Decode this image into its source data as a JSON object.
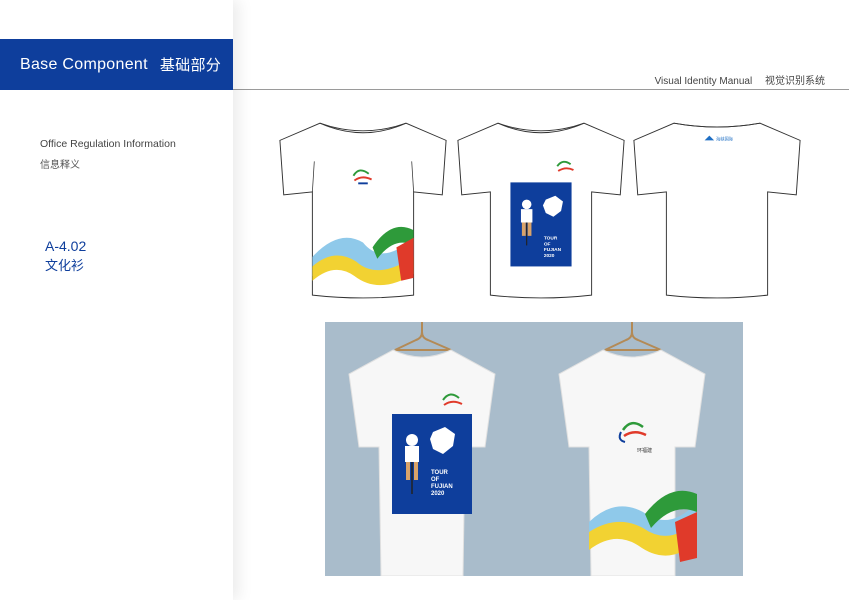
{
  "header": {
    "title_en": "Base Component",
    "title_cn": "基础部分"
  },
  "manual": {
    "title_en": "Visual Identity Manual",
    "title_cn": "视觉识别系统"
  },
  "section": {
    "title_en": "Office Regulation Information",
    "title_cn": "信息释义",
    "code": "A-4.02",
    "item_cn": "文化衫"
  },
  "artwork": {
    "race_line1": "TOUR",
    "race_line2": "OF",
    "race_line3": "FUJIAN",
    "race_year": "2020",
    "logo_cn": "环福建",
    "back_logo_cn": "海峡国际"
  },
  "colors": {
    "brand_blue": "#0e3e9c",
    "wave_green": "#2e9a3a",
    "wave_yellow": "#f2d232",
    "wave_red": "#e03a2a",
    "wave_lightblue": "#8fc9ea",
    "photo_bg": "#a9bccb"
  },
  "icons": [
    "shirt-front-wave",
    "shirt-front-poster",
    "shirt-back-logo",
    "hanger-icon",
    "cyclist-illustration",
    "fujian-map-icon",
    "race-logo-icon"
  ]
}
